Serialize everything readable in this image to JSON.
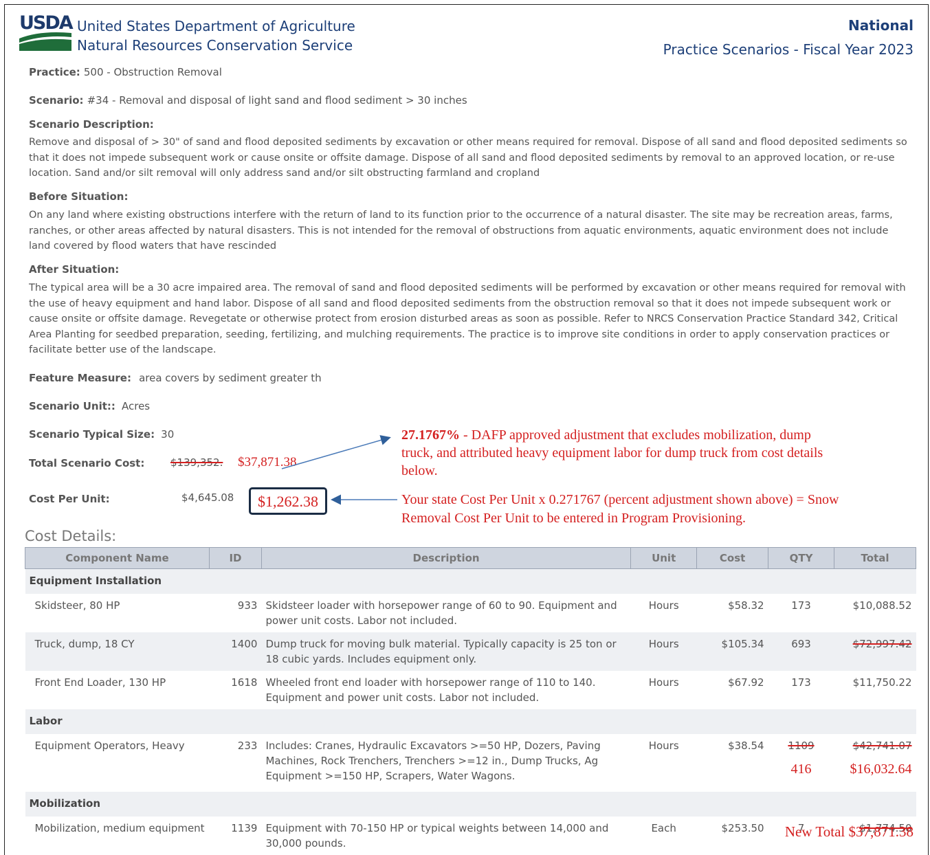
{
  "header": {
    "logo_text": "USDA",
    "dept_line1": "United States Department of Agriculture",
    "dept_line2": "Natural Resources Conservation Service",
    "national": "National",
    "practice_scenarios": "Practice Scenarios - Fiscal Year 2023"
  },
  "fields": {
    "practice_label": "Practice:",
    "practice_value": "500 - Obstruction Removal",
    "scenario_label": "Scenario:",
    "scenario_value": "#34 - Removal and disposal of light sand and flood sediment > 30 inches",
    "scen_desc_label": "Scenario Description:",
    "scen_desc": "Remove and disposal of > 30\" of sand and flood deposited sediments by excavation or other means required for removal. Dispose of all sand and flood deposited sediments so that it does not impede subsequent work or cause onsite or offsite damage. Dispose of all sand and flood deposited sediments by removal to an approved location, or re-use location. Sand and/or silt removal will only address sand and/or silt obstructing farmland and cropland",
    "before_label": "Before Situation:",
    "before": "On any land where existing obstructions interfere with the return of land to its function prior to the occurrence of a natural disaster. The site may be recreation areas, farms, ranches, or other areas affected by natural disasters. This is not intended for the removal of obstructions from aquatic environments, aquatic environment does not include land covered by flood waters that have rescinded",
    "after_label": "After Situation:",
    "after": "The typical area will be a 30 acre impaired area. The removal of sand and flood deposited sediments will be performed by excavation or other means required for removal with the use of heavy equipment and hand labor. Dispose of all sand and flood deposited sediments from the obstruction removal so that it does not impede subsequent work or cause onsite or offsite damage. Revegetate or otherwise protect from erosion disturbed areas as soon as possible. Refer to NRCS Conservation Practice Standard 342, Critical Area Planting for seedbed preparation, seeding, fertilizing, and mulching requirements. The practice is to improve site conditions in order to apply conservation practices or facilitate better use of the landscape.",
    "feature_label": "Feature Measure:",
    "feature_value": "area covers by sediment greater th",
    "unit_label": "Scenario Unit::",
    "unit_value": "Acres",
    "typical_label": "Scenario Typical Size:",
    "typical_value": "30",
    "total_label": "Total Scenario Cost:",
    "total_old": "$139,352.",
    "total_new": "$37,871.38",
    "cpu_label": "Cost Per Unit:",
    "cpu_old": "$4,645.08",
    "cpu_new": "$1,262.38"
  },
  "annotations": {
    "pct_bold": "27.1767%",
    "pct_line1_rest": " - DAFP approved adjustment that excludes mobilization, dump",
    "pct_line2": "truck, and attributed heavy equipment labor for dump truck from cost details",
    "pct_line3": "below.",
    "cpu_note_line1": "Your state Cost Per Unit x 0.271767 (percent adjustment shown above) = Snow",
    "cpu_note_line2": "Removal Cost Per Unit to be entered in Program Provisioning.",
    "new_total_label": "New Total",
    "new_total_value": "$37,871.38",
    "labor_qty_new": "416",
    "labor_total_new": "$16,032.64"
  },
  "cost_details": {
    "title": "Cost Details:",
    "headers": [
      "Component Name",
      "ID",
      "Description",
      "Unit",
      "Cost",
      "QTY",
      "Total"
    ],
    "groups": [
      {
        "name": "Equipment Installation",
        "rows": [
          {
            "name": "Skidsteer, 80 HP",
            "id": "933",
            "desc": "Skidsteer loader with horsepower range of 60 to 90. Equipment and power unit costs. Labor not included.",
            "unit": "Hours",
            "cost": "$58.32",
            "qty": "173",
            "total": "$10,088.52"
          },
          {
            "name": "Truck, dump, 18 CY",
            "id": "1400",
            "desc": "Dump truck for moving bulk material. Typically capacity is 25 ton or 18 cubic yards. Includes equipment only.",
            "unit": "Hours",
            "cost": "$105.34",
            "qty": "693",
            "total": "$72,997.42"
          },
          {
            "name": "Front End Loader, 130 HP",
            "id": "1618",
            "desc": "Wheeled front end loader with horsepower range of 110 to 140. Equipment and power unit costs. Labor not included.",
            "unit": "Hours",
            "cost": "$67.92",
            "qty": "173",
            "total": "$11,750.22"
          }
        ]
      },
      {
        "name": "Labor",
        "rows": [
          {
            "name": "Equipment Operators, Heavy",
            "id": "233",
            "desc": "Includes: Cranes, Hydraulic Excavators >=50 HP, Dozers, Paving Machines, Rock Trenchers, Trenchers >=12 in., Dump Trucks, Ag Equipment >=150 HP, Scrapers, Water Wagons.",
            "unit": "Hours",
            "cost": "$38.54",
            "qty": "1109",
            "total": "$42,741.07"
          }
        ]
      },
      {
        "name": "Mobilization",
        "rows": [
          {
            "name": "Mobilization, medium equipment",
            "id": "1139",
            "desc": "Equipment with 70-150 HP or typical weights between 14,000 and 30,000 pounds.",
            "unit": "Each",
            "cost": "$253.50",
            "qty": "7",
            "total": "$1,774.50"
          }
        ]
      }
    ]
  },
  "colors": {
    "accent_red": "#d42020",
    "usda_blue": "#1d3f78",
    "header_gray": "#cfd5df"
  }
}
